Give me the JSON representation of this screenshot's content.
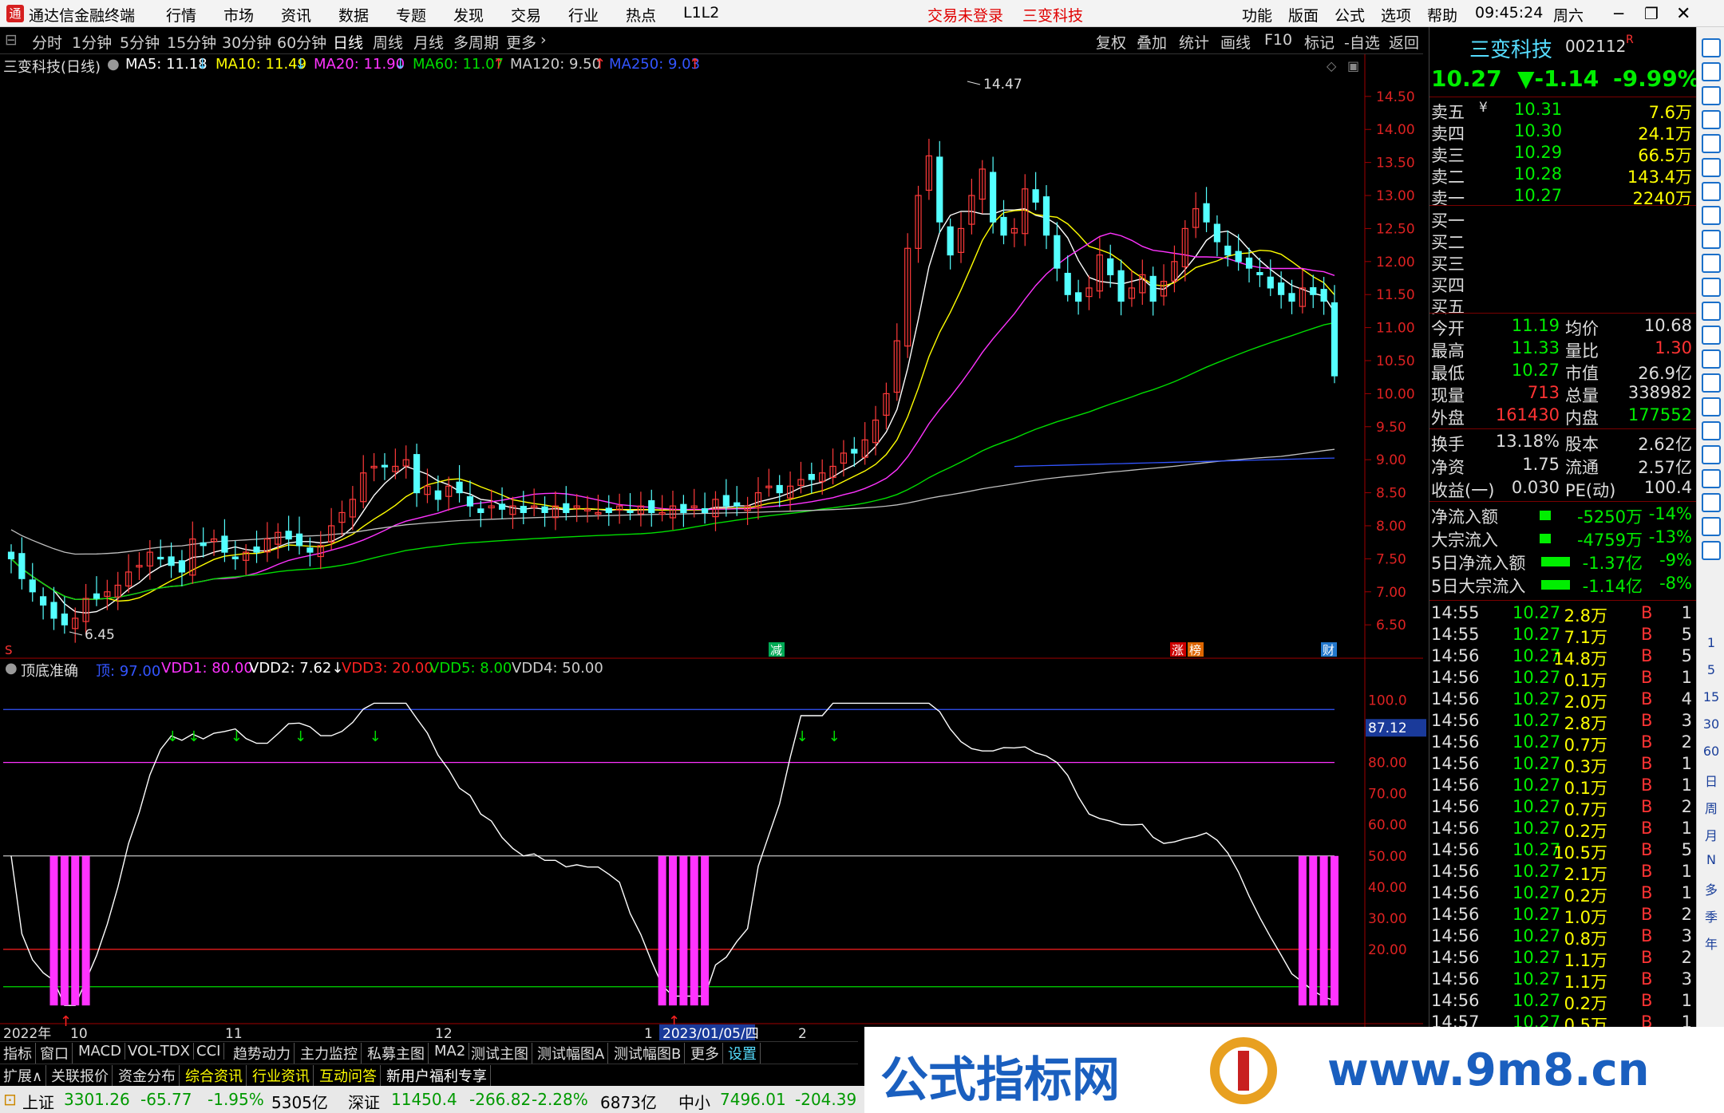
{
  "titlebar": {
    "app_title": "通达信金融终端",
    "menus": [
      "行情",
      "市场",
      "资讯",
      "数据",
      "专题",
      "发现",
      "交易",
      "行业",
      "热点",
      "L1L2"
    ],
    "trade_status": "交易未登录",
    "stock_name": "三变科技",
    "right_menus": [
      "功能",
      "版面",
      "公式",
      "选项",
      "帮助"
    ],
    "time": "09:45:24",
    "weekday": "周六"
  },
  "period_bar": {
    "items": [
      "分时",
      "1分钟",
      "5分钟",
      "15分钟",
      "30分钟",
      "60分钟",
      "日线",
      "周线",
      "月线",
      "多周期",
      "更多"
    ],
    "selected": "日线",
    "tools": [
      "复权",
      "叠加",
      "统计",
      "画线",
      "F10",
      "标记",
      "-自选",
      "返回"
    ]
  },
  "ma_bar": {
    "title": "三变科技(日线)",
    "items": [
      {
        "label": "MA5: 11.18",
        "arrow": "↓",
        "color": "#ffffff"
      },
      {
        "label": "MA10: 11.49",
        "arrow": "↓",
        "color": "#ffff00"
      },
      {
        "label": "MA20: 11.90",
        "arrow": "↓",
        "color": "#ff33ff"
      },
      {
        "label": "MA60: 11.07",
        "arrow": "↑",
        "color": "#00dd00"
      },
      {
        "label": "MA120: 9.50",
        "arrow": "↑",
        "color": "#c0c0c0"
      },
      {
        "label": "MA250: 9.03",
        "arrow": "↑",
        "color": "#3355ff"
      }
    ]
  },
  "price_axis": [
    "14.50",
    "14.00",
    "13.50",
    "13.00",
    "12.50",
    "12.00",
    "11.50",
    "11.00",
    "10.50",
    "10.00",
    "9.50",
    "9.00",
    "8.50",
    "8.00",
    "7.50",
    "7.00",
    "6.50"
  ],
  "price_annotations": {
    "high": "14.47",
    "low": "6.45"
  },
  "markers": {
    "s": "S",
    "jian": "减",
    "zhang": "涨",
    "bang": "榜",
    "cai": "财"
  },
  "indicator": {
    "name": "顶底准确",
    "items": [
      {
        "label": "顶: 97.00",
        "color": "#3355ff"
      },
      {
        "label": "VDD1: 80.00",
        "color": "#ff33ff"
      },
      {
        "label": "VDD2: 7.62↓",
        "color": "#ffffff"
      },
      {
        "label": "VDD3: 20.00",
        "color": "#ff2020"
      },
      {
        "label": "VDD5: 8.00",
        "color": "#00dd00"
      },
      {
        "label": "VDD4: 50.00",
        "color": "#c0c0c0"
      }
    ],
    "axis": [
      "100.0",
      "80.00",
      "70.00",
      "60.00",
      "50.00",
      "40.00",
      "30.00",
      "20.00"
    ],
    "cursor_value": "87.12"
  },
  "date_axis": {
    "labels": [
      "2022年",
      "10",
      "11",
      "12",
      "1",
      "2"
    ],
    "cursor_date": "2023/01/05/四"
  },
  "ind_tabs": [
    "指标",
    "窗口",
    "MACD",
    "VOL-TDX",
    "CCI",
    "趋势动力",
    "主力监控",
    "私募主图",
    "MA2",
    "测试主图",
    "测试幅图A",
    "测试幅图B",
    "更多",
    "设置"
  ],
  "ext_tabs": [
    "扩展∧",
    "关联报价",
    "资金分布",
    "综合资讯",
    "行业资讯",
    "互动问答",
    "新用户福利专享"
  ],
  "index_bar": {
    "sh": {
      "name": "上证",
      "value": "3301.26",
      "change": "-65.77",
      "pct": "-1.95%",
      "amount": "5305亿"
    },
    "sz": {
      "name": "深证",
      "value": "11450.4",
      "change": "-266.82",
      "pct": "-2.28%",
      "amount": "6873亿"
    },
    "zx": {
      "name": "中小",
      "value": "7496.01",
      "change": "-204.39"
    }
  },
  "quote": {
    "name": "三变科技",
    "code": "002112",
    "code_tag": "R",
    "price": "10.27",
    "change": "▼-1.14",
    "pct": "-9.99%",
    "asks": [
      {
        "label": "卖五",
        "price": "10.31",
        "vol": "7.6万"
      },
      {
        "label": "卖四",
        "price": "10.30",
        "vol": "24.1万"
      },
      {
        "label": "卖三",
        "price": "10.29",
        "vol": "66.5万"
      },
      {
        "label": "卖二",
        "price": "10.28",
        "vol": "143.4万"
      },
      {
        "label": "卖一",
        "price": "10.27",
        "vol": "2240万"
      }
    ],
    "ask5_suffix": "¥",
    "bids": [
      "买一",
      "买二",
      "买三",
      "买四",
      "买五"
    ],
    "stats": [
      {
        "l1": "今开",
        "v1": "11.19",
        "l2": "均价",
        "v2": "10.68"
      },
      {
        "l1": "最高",
        "v1": "11.33",
        "l2": "量比",
        "v2": "1.30"
      },
      {
        "l1": "最低",
        "v1": "10.27",
        "l2": "市值",
        "v2": "26.9亿"
      },
      {
        "l1": "现量",
        "v1": "713",
        "l2": "总量",
        "v2": "338982"
      },
      {
        "l1": "外盘",
        "v1": "161430",
        "l2": "内盘",
        "v2": "177552"
      }
    ],
    "stats2": [
      {
        "l1": "换手",
        "v1": "13.18%",
        "l2": "股本",
        "v2": "2.62亿"
      },
      {
        "l1": "净资",
        "v1": "1.75",
        "l2": "流通",
        "v2": "2.57亿"
      },
      {
        "l1": "收益(一)",
        "v1": "0.030",
        "l2": "PE(动)",
        "v2": "100.4"
      }
    ],
    "flows": [
      {
        "label": "净流入额",
        "value": "-5250万",
        "pct": "-14%"
      },
      {
        "label": "大宗流入",
        "value": "-4759万",
        "pct": "-13%"
      },
      {
        "label": "5日净流入额",
        "value": "-1.37亿",
        "pct": "-9%"
      },
      {
        "label": "5日大宗流入",
        "value": "-1.14亿",
        "pct": "-8%"
      }
    ],
    "ticks": [
      {
        "t": "14:55",
        "p": "10.27",
        "v": "2.8万",
        "bs": "B",
        "n": "1"
      },
      {
        "t": "14:55",
        "p": "10.27",
        "v": "7.1万",
        "bs": "B",
        "n": "5"
      },
      {
        "t": "14:56",
        "p": "10.27",
        "v": "14.8万",
        "bs": "B",
        "n": "5"
      },
      {
        "t": "14:56",
        "p": "10.27",
        "v": "0.1万",
        "bs": "B",
        "n": "1"
      },
      {
        "t": "14:56",
        "p": "10.27",
        "v": "2.0万",
        "bs": "B",
        "n": "4"
      },
      {
        "t": "14:56",
        "p": "10.27",
        "v": "2.8万",
        "bs": "B",
        "n": "3"
      },
      {
        "t": "14:56",
        "p": "10.27",
        "v": "0.7万",
        "bs": "B",
        "n": "2"
      },
      {
        "t": "14:56",
        "p": "10.27",
        "v": "0.3万",
        "bs": "B",
        "n": "1"
      },
      {
        "t": "14:56",
        "p": "10.27",
        "v": "0.1万",
        "bs": "B",
        "n": "1"
      },
      {
        "t": "14:56",
        "p": "10.27",
        "v": "0.7万",
        "bs": "B",
        "n": "2"
      },
      {
        "t": "14:56",
        "p": "10.27",
        "v": "0.2万",
        "bs": "B",
        "n": "1"
      },
      {
        "t": "14:56",
        "p": "10.27",
        "v": "10.5万",
        "bs": "B",
        "n": "5"
      },
      {
        "t": "14:56",
        "p": "10.27",
        "v": "2.1万",
        "bs": "B",
        "n": "1"
      },
      {
        "t": "14:56",
        "p": "10.27",
        "v": "0.2万",
        "bs": "B",
        "n": "1"
      },
      {
        "t": "14:56",
        "p": "10.27",
        "v": "1.0万",
        "bs": "B",
        "n": "2"
      },
      {
        "t": "14:56",
        "p": "10.27",
        "v": "0.8万",
        "bs": "B",
        "n": "3"
      },
      {
        "t": "14:56",
        "p": "10.27",
        "v": "1.1万",
        "bs": "B",
        "n": "2"
      },
      {
        "t": "14:56",
        "p": "10.27",
        "v": "1.1万",
        "bs": "B",
        "n": "3"
      },
      {
        "t": "14:56",
        "p": "10.27",
        "v": "0.2万",
        "bs": "B",
        "n": "1"
      },
      {
        "t": "14:57",
        "p": "10.27",
        "v": "0.5万",
        "bs": "B",
        "n": "1"
      }
    ]
  },
  "sidebar_labels": [
    "1",
    "5",
    "15",
    "30",
    "60",
    "日",
    "周",
    "月",
    "N",
    "多",
    "季",
    "年"
  ],
  "banner": {
    "text1": "公式指标网",
    "text2": "www.9m8.cn"
  },
  "chart_data": {
    "type": "candlestick",
    "price_range": [
      6.2,
      14.8
    ],
    "closes": [
      7.5,
      7.2,
      7.0,
      6.8,
      6.6,
      6.5,
      6.6,
      6.9,
      6.9,
      7.0,
      7.1,
      7.3,
      7.4,
      7.6,
      7.5,
      7.4,
      7.3,
      7.8,
      7.7,
      7.8,
      7.6,
      7.5,
      7.6,
      7.6,
      7.8,
      7.9,
      7.8,
      7.7,
      7.6,
      7.7,
      8.0,
      8.2,
      8.4,
      8.8,
      8.9,
      8.9,
      8.9,
      9.0,
      8.5,
      8.6,
      8.4,
      8.6,
      8.5,
      8.3,
      8.2,
      8.3,
      8.25,
      8.3,
      8.2,
      8.3,
      8.2,
      8.3,
      8.2,
      8.3,
      8.25,
      8.2,
      8.2,
      8.3,
      8.2,
      8.3,
      8.2,
      8.2,
      8.3,
      8.2,
      8.3,
      8.2,
      8.4,
      8.3,
      8.3,
      8.3,
      8.5,
      8.6,
      8.5,
      8.6,
      8.7,
      8.7,
      8.8,
      8.9,
      9.1,
      9.1,
      9.3,
      9.6,
      10.0,
      10.8,
      12.2,
      13.0,
      13.6,
      12.6,
      12.1,
      12.5,
      13.0,
      13.4,
      12.6,
      12.4,
      12.5,
      13.1,
      12.9,
      12.4,
      11.9,
      11.5,
      11.4,
      11.6,
      12.1,
      11.8,
      11.4,
      11.6,
      11.8,
      11.4,
      11.7,
      12.0,
      12.5,
      12.8,
      12.6,
      12.3,
      12.1,
      12.0,
      11.9,
      11.8,
      11.6,
      11.5,
      11.4,
      11.6,
      11.5,
      11.4,
      10.27
    ]
  }
}
